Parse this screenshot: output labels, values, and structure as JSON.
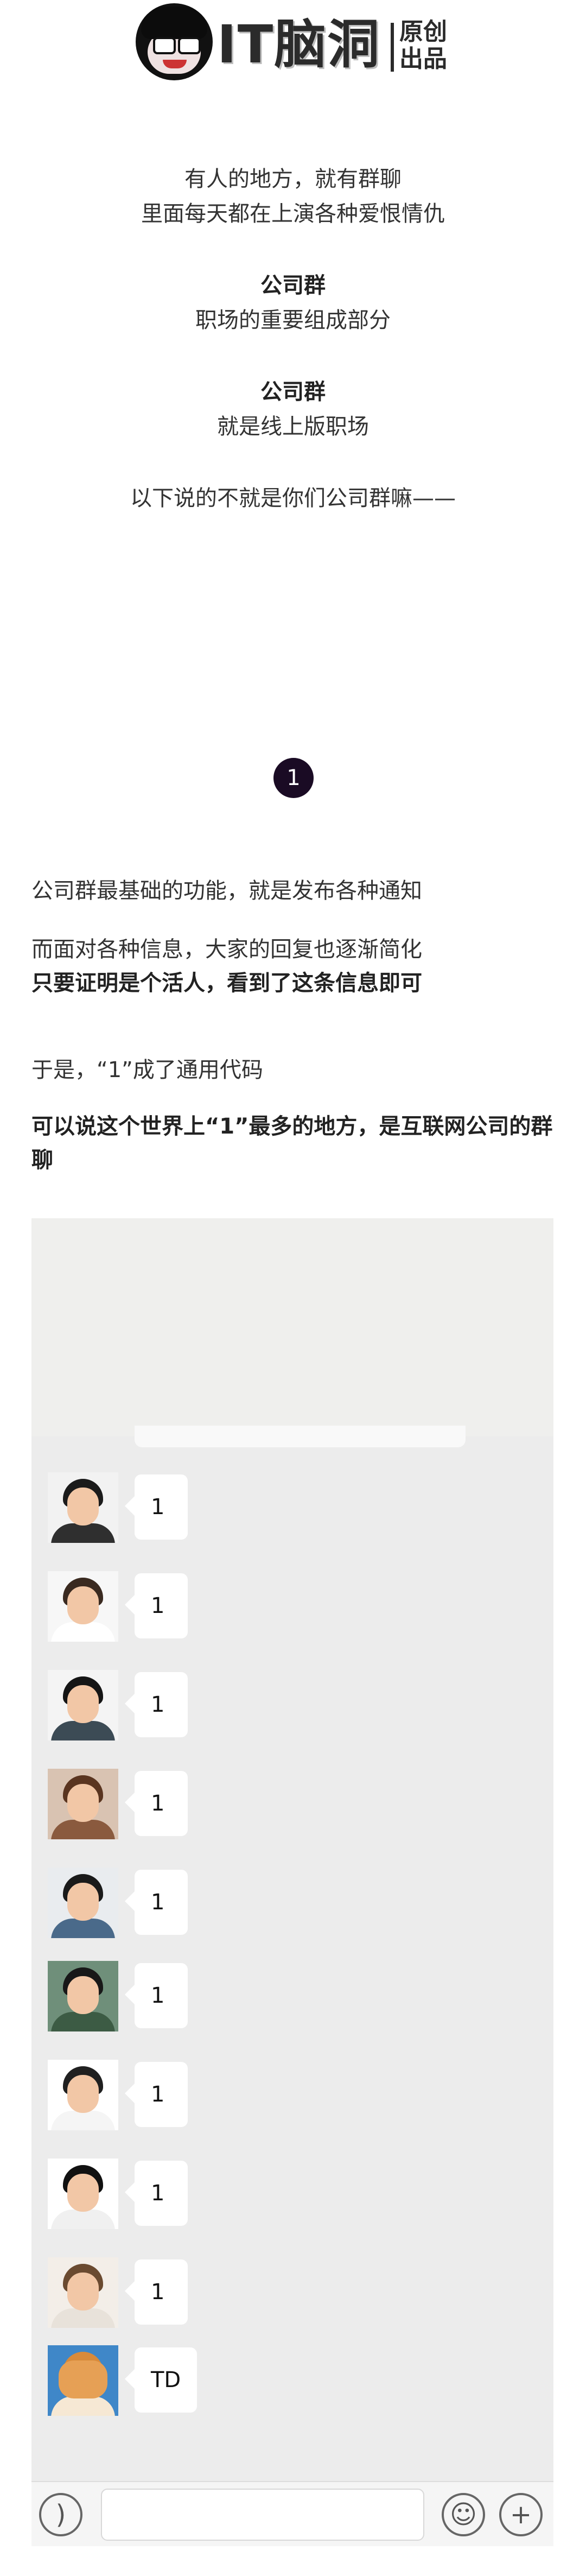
{
  "header": {
    "logo_title": "IT脑洞",
    "logo_sub": "原创出品"
  },
  "intro": {
    "line1": "有人的地方，就有群聊",
    "line2": "里面每天都在上演各种爱恨情仇",
    "heading1": "公司群",
    "line3": "职场的重要组成部分",
    "heading2": "公司群",
    "line4": "就是线上版职场",
    "line5": "以下说的不就是你们公司群嘛——"
  },
  "section": {
    "number": "1"
  },
  "body": {
    "p1": "公司群最基础的功能，就是发布各种通知",
    "p2": "而面对各种信息，大家的回复也逐渐简化",
    "p3": "只要证明是个活人，看到了这条信息即可",
    "p4": "于是，“1”成了通用代码",
    "p5": "可以说这个世界上“1”最多的地方，是互联网公司的群聊"
  },
  "chat": {
    "messages": [
      {
        "text": "1",
        "avatar": "man-red-collar-avatar",
        "hair": "#1b1b1b",
        "body": "#2f2f2f",
        "bg": "#f2f2f2"
      },
      {
        "text": "1",
        "avatar": "woman-long-hair-avatar",
        "hair": "#3a2a20",
        "body": "#ffffff",
        "bg": "#f7f7f7"
      },
      {
        "text": "1",
        "avatar": "man-dark-shirt-avatar",
        "hair": "#151515",
        "body": "#3c4b55",
        "bg": "#f4f4f4"
      },
      {
        "text": "1",
        "avatar": "woman-curly-hair-avatar",
        "hair": "#5a3520",
        "body": "#8a5a3e",
        "bg": "#d9c3b2"
      },
      {
        "text": "1",
        "avatar": "man-smiling-avatar",
        "hair": "#1a1a1a",
        "body": "#4a6a8a",
        "bg": "#e9ecef"
      },
      {
        "text": "1",
        "avatar": "man-glasses-avatar",
        "hair": "#181818",
        "body": "#3c5b44",
        "bg": "#6f8f7a"
      },
      {
        "text": "1",
        "avatar": "man-glasses-white-shirt-avatar",
        "hair": "#202020",
        "body": "#f5f5f5",
        "bg": "#ffffff"
      },
      {
        "text": "1",
        "avatar": "woman-peace-sign-avatar",
        "hair": "#111111",
        "body": "#f0f0f0",
        "bg": "#ffffff"
      },
      {
        "text": "1",
        "avatar": "man-brown-hair-avatar",
        "hair": "#6a4a30",
        "body": "#e8e2da",
        "bg": "#f3eee8"
      },
      {
        "text": "TD",
        "avatar": "shiba-dog-avatar",
        "hair": "#d88a3a",
        "body": "#f6e8d4",
        "bg": "#3f87c8"
      }
    ]
  },
  "input_bar": {
    "voice_icon": "voice-icon",
    "emoji_icon": "emoji-icon",
    "plus_icon": "plus-icon",
    "placeholder": ""
  }
}
